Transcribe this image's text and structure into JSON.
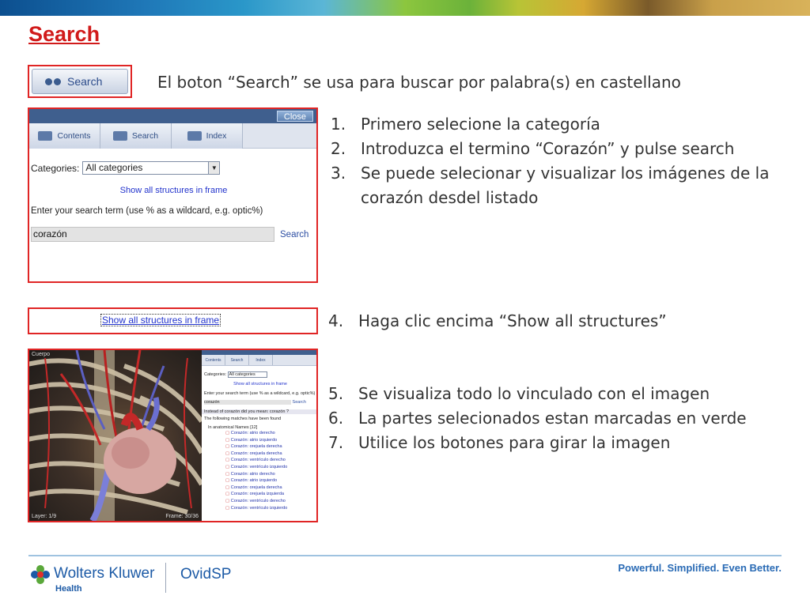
{
  "slide": {
    "title": "Search",
    "intro": "El boton “Search” se usa para buscar por palabra(s) en castellano"
  },
  "search_button_sample": {
    "label": "Search"
  },
  "search_panel": {
    "close_label": "Close",
    "tabs": [
      {
        "label": "Contents",
        "icon": "contents-icon"
      },
      {
        "label": "Search",
        "icon": "binoculars-icon"
      },
      {
        "label": "Index",
        "icon": "book-icon"
      }
    ],
    "categories_label": "Categories:",
    "categories_selected": "All categories",
    "show_all_link": "Show all structures in frame",
    "enter_label": "Enter your search term (use % as a wildcard, e.g. optic%)",
    "term_value": "corazón",
    "search_link": "Search"
  },
  "steps_a": [
    {
      "n": "1.",
      "text": "Primero selecione la categoría"
    },
    {
      "n": "2.",
      "text": "Introduzca el termino “Corazón” y pulse search"
    },
    {
      "n": "3.",
      "text": "Se puede selecionar y visualizar los imágenes de la corazón desdel listado"
    }
  ],
  "strip": {
    "link": "Show all structures in frame"
  },
  "steps_b": [
    {
      "n": "4.",
      "text": "Haga clic encima “Show all structures”"
    }
  ],
  "steps_c": [
    {
      "n": "5.",
      "text": "Se visualiza todo lo vinculado con el imagen"
    },
    {
      "n": "6.",
      "text": "La partes selecionados estan marcadas en verde"
    },
    {
      "n": "7.",
      "text": "Utilice los botones para girar la imagen"
    }
  ],
  "anatomy": {
    "viewer_caption": "Cuerpo",
    "layer_label": "Layer: 1/9",
    "frame_label": "Frame: 30/36",
    "side": {
      "tabs": [
        "Contents",
        "Search",
        "Index"
      ],
      "categories_label": "Categories:",
      "categories_selected": "All categories",
      "show_all": "Show all structures in frame",
      "enter_label": "Enter your search term (use % as a wildcard, e.g. optic%)",
      "term_value": "corazón",
      "search_link": "Search",
      "did_you_mean": "Instead of corazón did you mean: corazón ?",
      "matches": "The following matches have been found",
      "group": "In anatomical Names [12]",
      "results": [
        "Corazón: atrio derecho",
        "Corazón: atrio izquierdo",
        "Corazón: orejuela derecha",
        "Corazón: orejuela derecha",
        "Corazón: ventrículo derecho",
        "Corazón: ventrículo izquierdo",
        "Corazón: atrio derecho",
        "Corazón: atrio izquierdo",
        "Corazón: orejuela derecha",
        "Corazón: orejuela izquierda",
        "Corazón: ventrículo derecho",
        "Corazón: ventrículo izquierdo"
      ]
    }
  },
  "footer": {
    "brand_main": "Wolters Kluwer",
    "brand_sub": "Health",
    "product": "OvidSP",
    "tagline": "Powerful. Simplified. Even Better."
  },
  "colors": {
    "title_red": "#d11a1a",
    "frame_red": "#e02525",
    "link_blue": "#2233cc",
    "brand_blue": "#1c5aa6",
    "tagline_blue": "#2a6bb5"
  }
}
